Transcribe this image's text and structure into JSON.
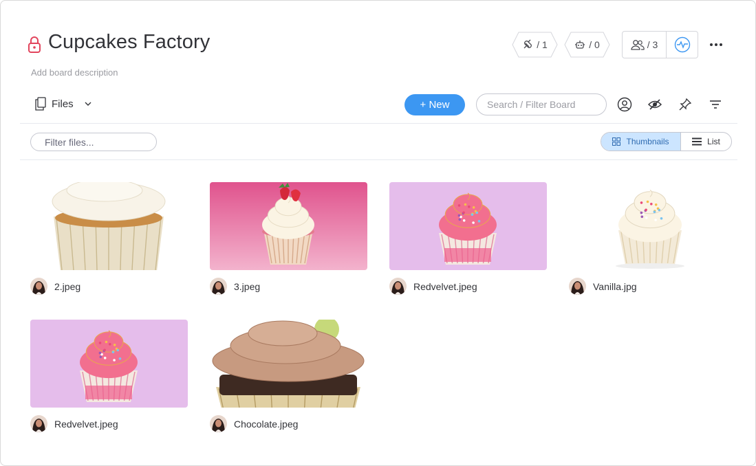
{
  "board": {
    "title": "Cupcakes Factory",
    "description_placeholder": "Add board description"
  },
  "header_stats": {
    "integrations": "/ 1",
    "automations": "/ 0",
    "members": "/ 3"
  },
  "toolbar": {
    "view_label": "Files",
    "new_button": "+ New",
    "search_placeholder": "Search / Filter Board"
  },
  "files_bar": {
    "filter_placeholder": "Filter files...",
    "view_thumbnails": "Thumbnails",
    "view_list": "List"
  },
  "files": [
    {
      "name": "2.jpeg",
      "thumb": "vanilla-closeup"
    },
    {
      "name": "3.jpeg",
      "thumb": "strawberry-pink"
    },
    {
      "name": "Redvelvet.jpeg",
      "thumb": "sprinkle-purple"
    },
    {
      "name": "Vanilla.jpg",
      "thumb": "vanilla-white"
    },
    {
      "name": "Redvelvet.jpeg",
      "thumb": "sprinkle-purple"
    },
    {
      "name": "Chocolate.jpeg",
      "thumb": "chocolate-frosting"
    }
  ],
  "colors": {
    "accent": "#3c97f2",
    "lock": "#e2445c",
    "toggle_active_bg": "#cce5ff"
  },
  "icons": [
    "lock-icon",
    "integrations-icon",
    "automations-icon",
    "members-icon",
    "activity-icon",
    "more-icon",
    "files-icon",
    "chevron-down-icon",
    "person-filter-icon",
    "hide-icon",
    "pin-icon",
    "filter-icon",
    "thumbnails-icon",
    "list-icon"
  ]
}
